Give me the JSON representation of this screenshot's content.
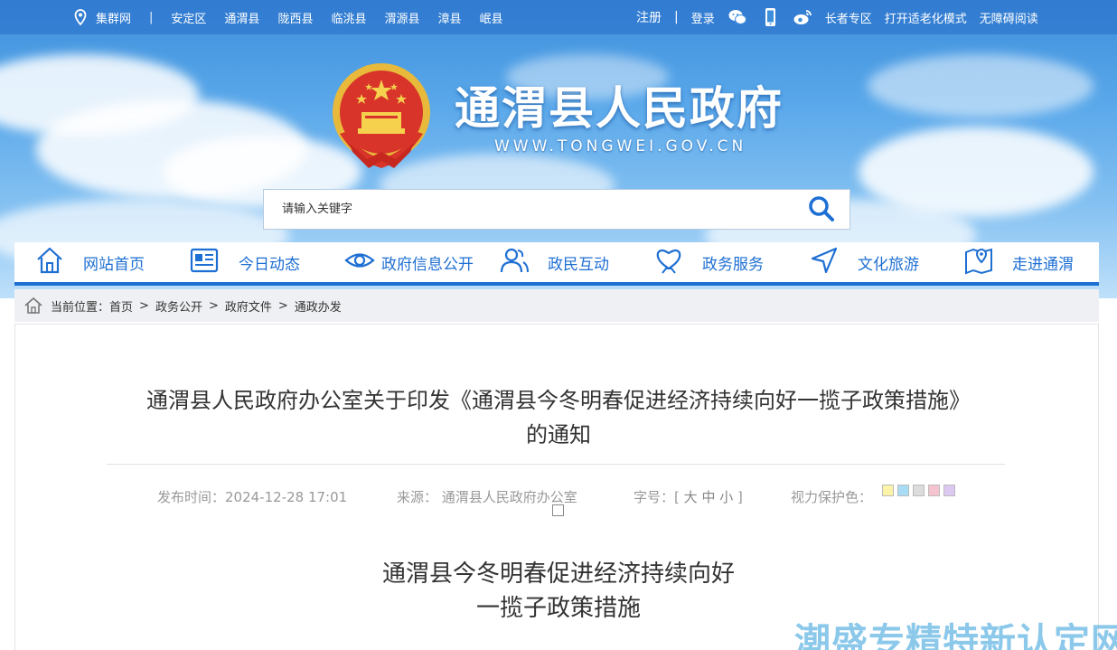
{
  "topbar": {
    "links_left": [
      "集群网",
      "|",
      "安定区",
      "通渭县",
      "陇西县",
      "临洮县",
      "渭源县",
      "漳县",
      "岷县"
    ],
    "register": "注册",
    "divider": "|",
    "login": "登录",
    "elder": "长者专区",
    "aging_mode": "打开适老化模式",
    "accessible": "无障碍阅读"
  },
  "site": {
    "title": "通渭县人民政府",
    "url": "WWW.TONGWEI.GOV.CN"
  },
  "search": {
    "placeholder": "请输入关键字"
  },
  "nav": [
    {
      "label": "网站首页",
      "icon": "home-icon"
    },
    {
      "label": "今日动态",
      "icon": "news-icon"
    },
    {
      "label": "政府信息公开",
      "icon": "eye-icon"
    },
    {
      "label": "政民互动",
      "icon": "people-icon"
    },
    {
      "label": "政务服务",
      "icon": "heart-hand-icon"
    },
    {
      "label": "文化旅游",
      "icon": "send-icon"
    },
    {
      "label": "走进通渭",
      "icon": "map-pin-icon"
    }
  ],
  "breadcrumb": {
    "prefix": "当前位置：",
    "items": [
      "首页",
      "政务公开",
      "政府文件",
      "通政办发"
    ],
    "sep": ">"
  },
  "article": {
    "title_line1": "通渭县人民政府办公室关于印发《通渭县今冬明春促进经济持续向好一揽子政策措施》",
    "title_line2": "的通知",
    "publish": "发布时间：2024-12-28 17:01",
    "source": "来源：  通渭县人民政府办公室",
    "font_size_label": "字号：[",
    "font_large": "大",
    "font_medium": "中",
    "font_small": "小",
    "font_close": "]",
    "eye_color_label": "视力保护色：",
    "swatch_colors": [
      "#faf3a8",
      "#a8dcf5",
      "#dcdcdc",
      "#f5c2d0",
      "#dcc8f0"
    ],
    "doc_title_line1": "通渭县今冬明春促进经济持续向好",
    "doc_title_line2": "一揽子政策措施"
  },
  "watermark": "潮盛专精特新认定网"
}
